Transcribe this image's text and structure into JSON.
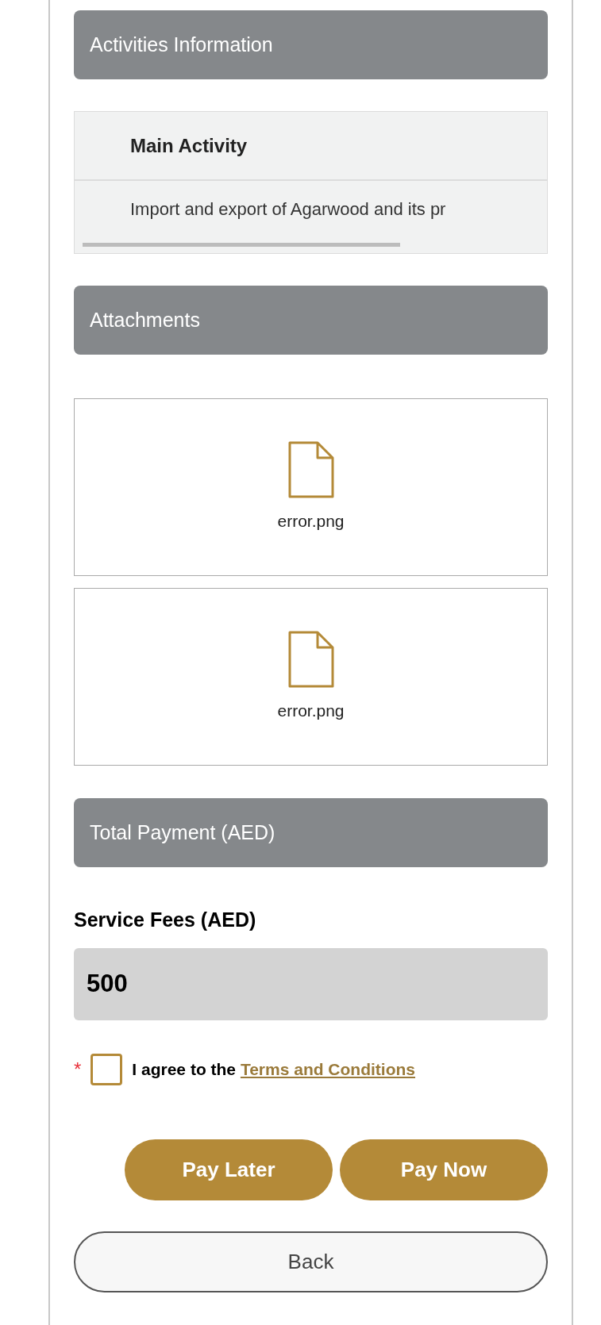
{
  "activities": {
    "title": "Activities Information",
    "table": {
      "columns": [
        "Main Activity"
      ],
      "rows": [
        [
          "Import and export of Agarwood and its pr"
        ]
      ]
    }
  },
  "attachments": {
    "title": "Attachments",
    "files": [
      {
        "name": "error.png"
      },
      {
        "name": "error.png"
      }
    ]
  },
  "payment": {
    "title": "Total Payment (AED)",
    "fee_label": "Service Fees (AED)",
    "fee_value": "500",
    "required_mark": "*",
    "agree": {
      "checked": false,
      "text": "I agree to the",
      "link": "Terms and Conditions"
    },
    "buttons": [
      "Pay Later",
      "Pay Now"
    ],
    "back": "Back"
  }
}
